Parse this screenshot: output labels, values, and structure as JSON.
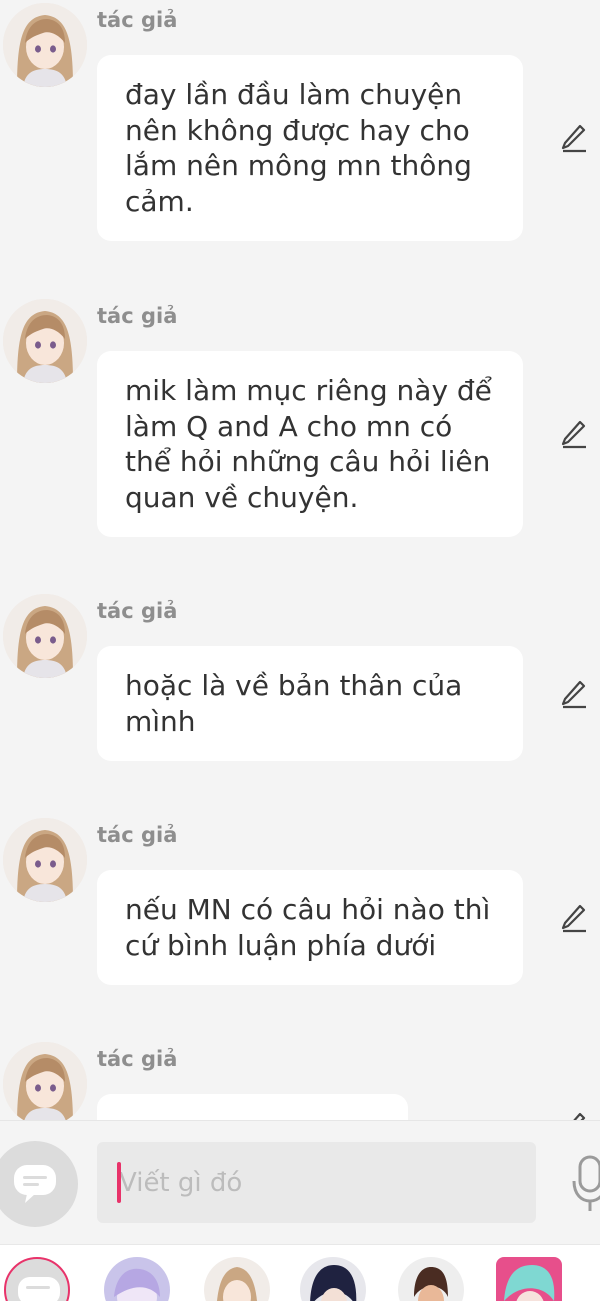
{
  "messages": [
    {
      "author": "tác giả",
      "text": "đay lần đầu làm chuyện nên không được hay cho lắm nên mông mn thông cảm."
    },
    {
      "author": "tác giả",
      "text": "mik làm mục riêng này để làm Q and A cho mn có thể hỏi những câu hỏi liên quan về chuyện."
    },
    {
      "author": "tác giả",
      "text": "hoặc là về bản thân của mình"
    },
    {
      "author": "tác giả",
      "text": "nếu MN có câu hỏi nào thì cứ bình luận phía dưới"
    },
    {
      "author": "tác giả",
      "text": ""
    }
  ],
  "icons": {
    "edit": "pencil-icon",
    "composer_toggle": "chat-bubble-icon",
    "mic": "microphone-icon"
  },
  "composer": {
    "placeholder": "Viết gì đó",
    "value": ""
  },
  "colors": {
    "background": "#f4f4f4",
    "bubble": "#ffffff",
    "author_text": "#8e8e8e",
    "caret_accent": "#e8336a"
  }
}
